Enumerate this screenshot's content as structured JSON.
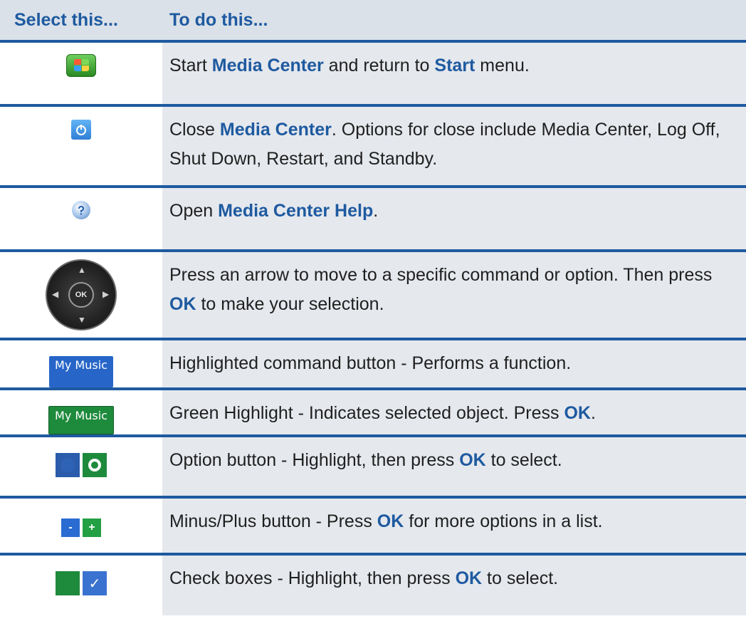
{
  "header": {
    "col1": "Select this...",
    "col2": "To do this..."
  },
  "rows": [
    {
      "icon": "windows-start-icon",
      "t1": "Start ",
      "k1": "Media Center",
      "t2": " and return to ",
      "k2": "Start",
      "t3": " menu."
    },
    {
      "icon": "power-icon",
      "t1": "Close ",
      "k1": "Media Center",
      "t2": ". Options for close include Media Center, Log Off, Shut Down, Restart, and Standby."
    },
    {
      "icon": "help-icon",
      "t1": "Open ",
      "k1": "Media Center Help",
      "t2": "."
    },
    {
      "icon": "dpad-icon",
      "ok_label": "OK",
      "t1": "Press an arrow to move to a specific command or option. Then press ",
      "k1": "OK",
      "t2": " to make your selection."
    },
    {
      "icon": "highlighted-button-icon",
      "pill_label": "My Music",
      "t1": "Highlighted command button - Performs a function."
    },
    {
      "icon": "green-highlight-icon",
      "pill_label": "My Music",
      "t1": "Green Highlight - Indicates selected object. Press ",
      "k1": "OK",
      "t2": "."
    },
    {
      "icon": "option-button-icon",
      "t1": "Option button - Highlight, then press ",
      "k1": "OK",
      "t2": " to select."
    },
    {
      "icon": "minus-plus-icon",
      "minus": "-",
      "plus": "+",
      "t1": "Minus/Plus button - Press ",
      "k1": "OK",
      "t2": " for more options in a list."
    },
    {
      "icon": "checkbox-icon",
      "check": "✓",
      "t1": "Check boxes - Highlight, then press ",
      "k1": "OK",
      "t2": " to select."
    }
  ],
  "colors": {
    "accent": "#1e5aa0",
    "header_bg": "#dbe1e9",
    "row_bg": "#e5e8ed"
  }
}
